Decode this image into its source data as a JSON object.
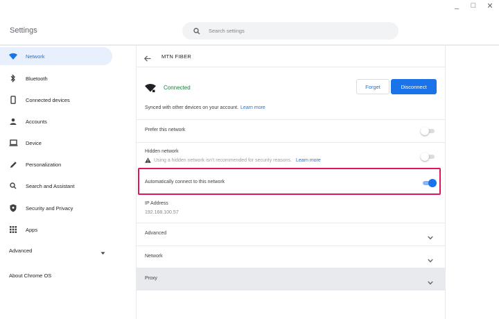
{
  "window": {
    "minimize": "_",
    "maximize": "□",
    "close": "✕"
  },
  "header": {
    "title": "Settings",
    "search_placeholder": "Search settings",
    "search_icon": "search-icon"
  },
  "sidebar": {
    "items": [
      {
        "label": "Network",
        "icon": "wifi-icon",
        "active": true
      },
      {
        "label": "Bluetooth",
        "icon": "bluetooth-icon"
      },
      {
        "label": "Connected devices",
        "icon": "phone-icon"
      },
      {
        "label": "Accounts",
        "icon": "person-icon"
      },
      {
        "label": "Device",
        "icon": "laptop-icon"
      },
      {
        "label": "Personalization",
        "icon": "pencil-icon"
      },
      {
        "label": "Search and Assistant",
        "icon": "search-icon"
      },
      {
        "label": "Security and Privacy",
        "icon": "shield-icon"
      },
      {
        "label": "Apps",
        "icon": "apps-grid-icon"
      }
    ],
    "advanced": "Advanced",
    "about": "About Chrome OS"
  },
  "main": {
    "network_name": "MTN FIBER",
    "status": "Connected",
    "forget_label": "Forget",
    "disconnect_label": "Disconnect",
    "sync_text": "Synced with other devices on your account.",
    "learn_more": "Learn more",
    "prefer_label": "Prefer this network",
    "prefer_on": false,
    "hidden_label": "Hidden network",
    "hidden_on": false,
    "hidden_warning": "Using a hidden network isn't recommended for security reasons.",
    "hidden_learn_more": "Learn more",
    "auto_connect_label": "Automatically connect to this network",
    "auto_connect_on": true,
    "ip_label": "IP Address",
    "ip_value": "192.168.100.57",
    "sections": [
      {
        "label": "Advanced"
      },
      {
        "label": "Network"
      },
      {
        "label": "Proxy"
      }
    ]
  },
  "colors": {
    "accent": "#1a73e8",
    "connected": "#188038",
    "highlight": "#e0145a"
  }
}
